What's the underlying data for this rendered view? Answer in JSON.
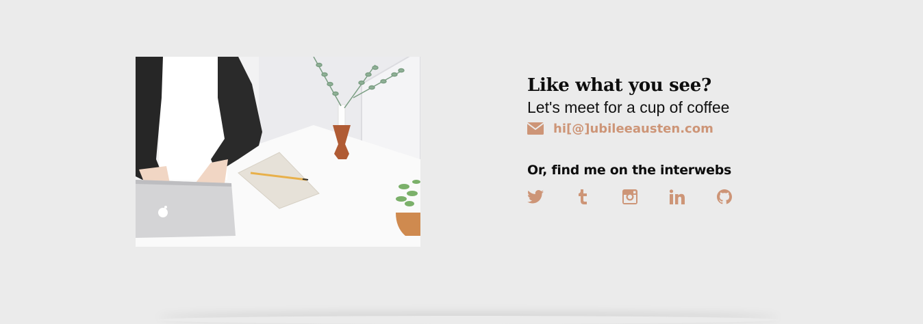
{
  "contact": {
    "heading": "Like what you see?",
    "subheading": "Let's meet for a cup of coffee",
    "email_icon": "envelope-icon",
    "email": "hi[@]ubileeausten.com",
    "social_title": "Or, find me on the interwebs",
    "social_links": [
      {
        "name": "twitter",
        "icon": "twitter-icon"
      },
      {
        "name": "tumblr",
        "icon": "tumblr-icon"
      },
      {
        "name": "instagram",
        "icon": "instagram-icon"
      },
      {
        "name": "linkedin",
        "icon": "linkedin-icon"
      },
      {
        "name": "github",
        "icon": "github-icon"
      }
    ]
  },
  "colors": {
    "background": "#ebebeb",
    "accent": "#cd9577",
    "text": "#0d0d0d"
  }
}
